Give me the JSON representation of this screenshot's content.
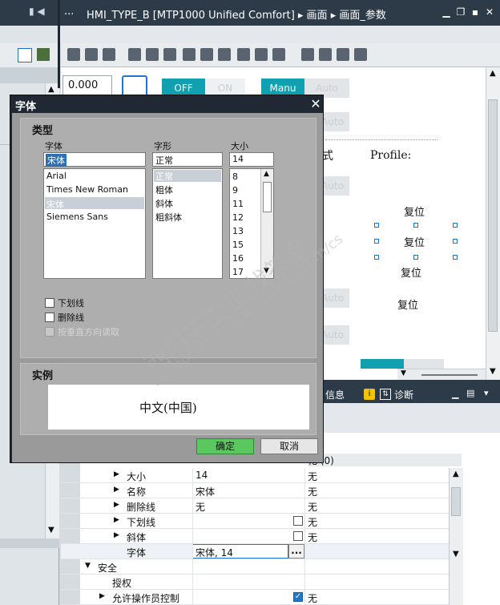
{
  "window": {
    "title": "HMI_TYPE_B [MTP1000 Unified Comfort] ▸ 画面 ▸ 画面_参数",
    "nav_prefix": "...",
    "nav_icons": "▮ ◀"
  },
  "canvas": {
    "numeric_value": "0.000",
    "off_label": "OFF",
    "on_label": "ON",
    "manu_label": "Manu",
    "auto_label": "Auto",
    "profile_label": "Profile:",
    "partial_char": "式",
    "reset_labels": [
      "复位",
      "复位",
      "复位",
      "复位"
    ]
  },
  "bottom_tabs": {
    "info": "信息",
    "diag": "诊断"
  },
  "properties": {
    "header_right": "化 (0)",
    "rows": [
      {
        "label": "大小",
        "value": "14",
        "w": "无"
      },
      {
        "label": "名称",
        "value": "宋体",
        "w": "无"
      },
      {
        "label": "删除线",
        "value": "无",
        "w": "无"
      },
      {
        "label": "下划线",
        "value": "",
        "w": "无"
      },
      {
        "label": "斜体",
        "value": "",
        "w": "无"
      },
      {
        "label": "字体",
        "value": "宋体, 14",
        "w": ""
      },
      {
        "label": "安全",
        "value": "",
        "w": ""
      },
      {
        "label": "授权",
        "value": "",
        "w": ""
      },
      {
        "label": "允许操作员控制",
        "value": "",
        "w": "无"
      }
    ],
    "ellipsis": "..."
  },
  "dialog": {
    "title": "字体",
    "close": "✕",
    "type_group": "类型",
    "font_label": "字体",
    "style_label": "字形",
    "size_label": "大小",
    "font_value": "宋体",
    "style_value": "正常",
    "size_value": "14",
    "fonts": [
      "Arial",
      "Times New Roman",
      "宋体",
      "Siemens Sans"
    ],
    "styles": [
      "正常",
      "粗体",
      "斜体",
      "粗斜体"
    ],
    "sizes": [
      "8",
      "9",
      "11",
      "12",
      "13",
      "15",
      "16",
      "17"
    ],
    "underline": "下划线",
    "strikethrough": "删除线",
    "vertical": "按垂直方向读取",
    "sample_group": "实例",
    "sample_text": "中文(中国)",
    "ok": "确定",
    "cancel": "取消"
  },
  "watermark": {
    "line1": "西门子工业   找答案",
    "line2": "support.industry.siemens.com/cs"
  }
}
